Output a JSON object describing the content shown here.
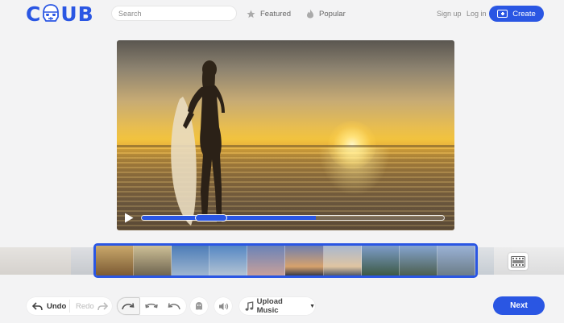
{
  "header": {
    "logo_left": "C",
    "logo_right": "UB",
    "search_placeholder": "Search",
    "nav": {
      "featured": "Featured",
      "popular": "Popular"
    },
    "signup": "Sign up",
    "login": "Log in",
    "create": "Create"
  },
  "video": {
    "progress_fraction": 0.575,
    "handle_position_fraction": 0.19
  },
  "toolbar": {
    "undo": "Undo",
    "redo": "Redo",
    "upload_music": "Upload Music",
    "next": "Next"
  },
  "colors": {
    "accent": "#2a56e3",
    "background": "#f3f3f4"
  },
  "icons": [
    "stormtrooper-logo-icon",
    "star-icon",
    "flame-icon",
    "create-plus-icon",
    "play-icon",
    "film-icon",
    "undo-icon",
    "redo-icon",
    "loop-forward-icon",
    "loop-bounce-icon",
    "loop-reverse-icon",
    "ghost-icon",
    "volume-icon",
    "music-note-icon"
  ]
}
